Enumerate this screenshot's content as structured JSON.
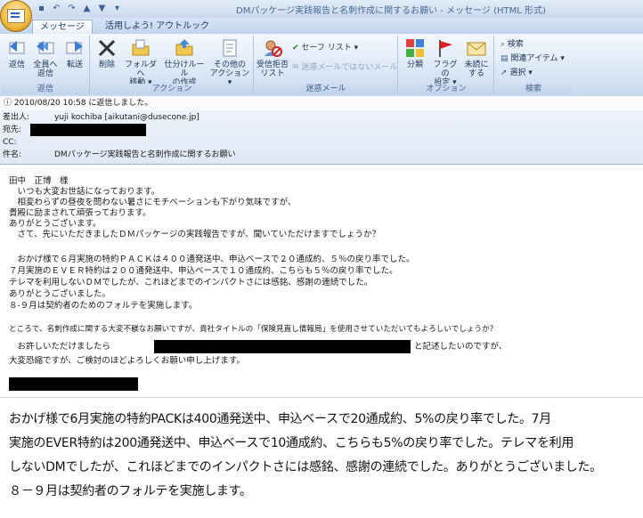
{
  "window": {
    "title": "DMパッケージ実践報告と名刺作成に関するお願い - メッセージ (HTML 形式)"
  },
  "tabs": [
    {
      "label": "メッセージ",
      "active": true
    },
    {
      "label": "活用しよう! アウトルック",
      "active": false
    }
  ],
  "ribbon": {
    "respond": {
      "label": "返信",
      "reply": "返信",
      "reply_all_1": "全員へ",
      "reply_all_2": "返信",
      "forward": "転送"
    },
    "actions": {
      "label": "アクション",
      "delete": "削除",
      "move_1": "フォルダへ",
      "move_2": "移動 ▾",
      "rule_1": "仕分けルール",
      "rule_2": "の作成",
      "other_1": "その他の",
      "other_2": "アクション ▾"
    },
    "junk": {
      "label": "迷惑メール",
      "block_1": "受信拒否",
      "block_2": "リスト",
      "safe_list": "セーフ リスト ▾",
      "not_junk": "迷惑メールではないメール"
    },
    "options": {
      "label": "オプション",
      "categorize": "分類",
      "followup_1": "フラグの",
      "followup_2": "設定 ▾",
      "unread_1": "未読に",
      "unread_2": "する"
    },
    "find": {
      "label": "検索",
      "find": "検索",
      "related": "関連アイテム ▾",
      "select": "選択 ▾"
    }
  },
  "infobar": {
    "text": "2010/08/20 10:58 に返信しました。"
  },
  "header": {
    "from_label": "差出人:",
    "from_value": "yuji kochiba [aikutani@dusecone.jp]",
    "to_label": "宛先:",
    "cc_label": "CC:",
    "subject_label": "件名:",
    "subject_value": "DMパッケージ実践報告と名刺作成に関するお願い"
  },
  "body": {
    "lines": [
      "田中　正博　様",
      "　いつも大変お世話になっております。",
      "　相変わらずの昼夜を問わない暑さにモチベーションも下がり気味ですが、",
      "貴殿に励まされて頑張っております。",
      "ありがとうございます。",
      "　さて、先にいただきましたＤＭパッケージの実践報告ですが、聞いていただけますでしょうか？",
      "",
      "　おかげ様で６月実施の特約ＰＡＣＫは４００通発送中、申込ベースで２０通成約、５％の戻り率でした。",
      "７月実施のＥＶＥＲ特約は２００通発送中、申込ベースで１０通成約、こちらも５％の戻り率でした。",
      "テレマを利用しないＤＭでしたが、これほどまでのインパクトさには感銘、感謝の連続でした。",
      "ありがとうございました。",
      "８-９月は契約者のためのフォルテを実施します。",
      "",
      "ところで、名刺作成に関する大変不躾なお願いですが、貴社タイトルの「保険見直し情報局」を使用させていただいてもよろしいでしょうか？",
      "　お許しいただけましたら",
      "大変恐縮ですが、ご検討のほどよろしくお願い申し上げます。"
    ],
    "line_after_redact": "と記述したいのですが、"
  },
  "caption": {
    "lines": [
      "おかげ様で6月実施の特約PACKは400通発送中、申込ベースで20通成約、5%の戻り率でした。7月",
      "実施のEVER特約は200通発送中、申込ベースで10通成約、こちらも5%の戻り率でした。テレマを利用",
      "しないDMでしたが、これほどまでのインパクトさには感銘、感謝の連続でした。ありがとうございました。",
      "８－９月は契約者のフォルテを実施します。"
    ]
  },
  "icons": [
    "office-button-icon",
    "save-icon",
    "undo-icon",
    "redo-icon",
    "up-icon",
    "down-icon",
    "reply-icon",
    "reply-all-icon",
    "forward-icon",
    "delete-icon",
    "move-folder-icon",
    "rule-icon",
    "other-actions-icon",
    "block-sender-icon",
    "safe-list-icon",
    "not-junk-icon",
    "categorize-icon",
    "flag-icon",
    "unread-icon",
    "find-icon",
    "related-icon",
    "select-icon"
  ]
}
